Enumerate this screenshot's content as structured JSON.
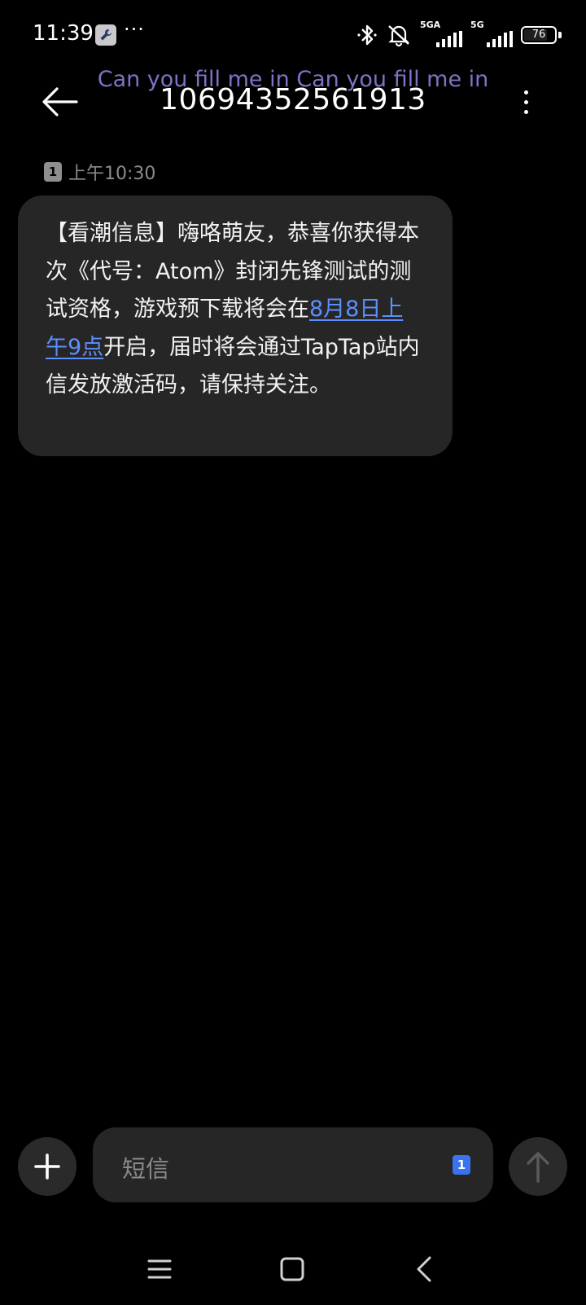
{
  "status_bar": {
    "time": "11:39",
    "overflow_dots": "···",
    "network_1_label": "5GA",
    "network_2_label": "5G",
    "battery_level": "76",
    "icons": [
      "wrench-icon",
      "bluetooth-icon",
      "ringer-off-icon",
      "signal-icon",
      "battery-icon"
    ]
  },
  "header": {
    "subtitle": "Can you fill me in Can you fill me in",
    "title": "10694352561913",
    "back_icon": "arrow-left-icon",
    "more_icon": "vertical-dots-icon"
  },
  "message": {
    "sim_slot": "1",
    "time": "上午10:30",
    "text_before_link": "【看潮信息】嗨咯萌友，恭喜你获得本次《代号：Atom》封闭先锋测试的测试资格，游戏预下载将会在",
    "link_text": "8月8日上午9点",
    "text_after_link": "开启，届时将会通过TapTap站内信发放激活码，请保持关注。"
  },
  "composer": {
    "placeholder": "短信",
    "sim_slot": "1",
    "add_icon": "plus-icon",
    "send_icon": "arrow-up-icon"
  },
  "nav_bar": {
    "icons": [
      "menu-icon",
      "home-icon",
      "back-icon"
    ]
  }
}
